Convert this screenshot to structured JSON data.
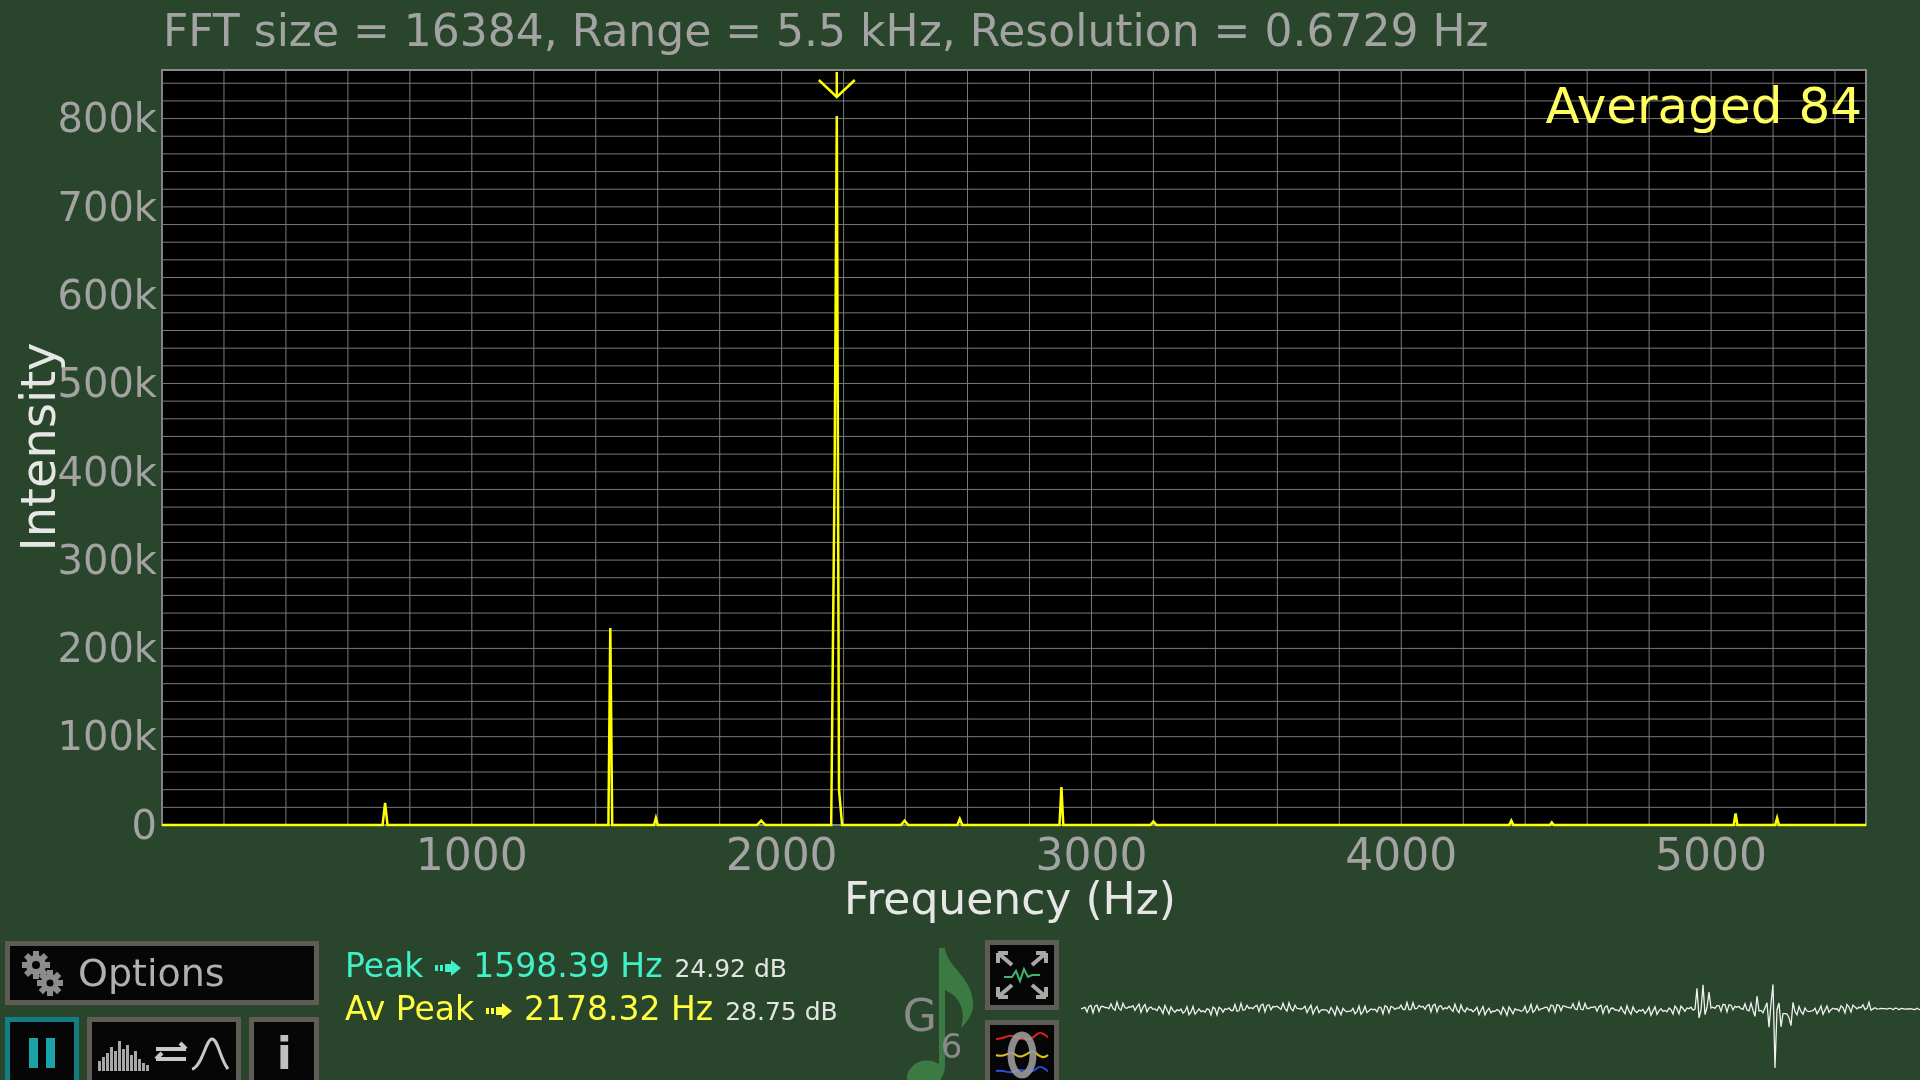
{
  "spectrum": {
    "title": "FFT size = 16384, Range = 5.5 kHz, Resolution = 0.6729 Hz",
    "status": "Averaged 84",
    "peak_marker": true,
    "chart_data": {
      "type": "line",
      "grid": true,
      "xlabel": "Frequency (Hz)",
      "ylabel": "Intensity",
      "xlim": [
        0,
        5500
      ],
      "ylim": [
        0,
        855000
      ],
      "xticks": [
        1000,
        2000,
        3000,
        4000,
        5000
      ],
      "yticks": [
        {
          "value": 0,
          "label": "0"
        },
        {
          "value": 100000,
          "label": "100k"
        },
        {
          "value": 200000,
          "label": "200k"
        },
        {
          "value": 300000,
          "label": "300k"
        },
        {
          "value": 400000,
          "label": "400k"
        },
        {
          "value": 500000,
          "label": "500k"
        },
        {
          "value": 600000,
          "label": "600k"
        },
        {
          "value": 700000,
          "label": "700k"
        },
        {
          "value": 800000,
          "label": "800k"
        }
      ],
      "x": [
        0,
        712,
        720,
        728,
        1441,
        1447,
        1453,
        1588,
        1594,
        1600,
        1920,
        1934,
        1948,
        2160,
        2171,
        2178,
        2185,
        2195,
        2385,
        2397,
        2409,
        2567,
        2575,
        2583,
        2897,
        2903,
        2909,
        3190,
        3200,
        3210,
        4348,
        4355,
        4362,
        4480,
        4486,
        4492,
        5073,
        5079,
        5085,
        5207,
        5213,
        5219,
        5500
      ],
      "series": [
        {
          "color": "#ffff00",
          "values": [
            0,
            0,
            25000,
            0,
            0,
            223000,
            0,
            0,
            8000,
            0,
            0,
            5000,
            0,
            0,
            400000,
            803000,
            40000,
            0,
            0,
            5000,
            0,
            0,
            7000,
            0,
            0,
            43000,
            0,
            0,
            4000,
            0,
            0,
            5000,
            0,
            0,
            3000,
            0,
            0,
            13000,
            0,
            0,
            8000,
            0,
            0
          ]
        }
      ]
    }
  },
  "controls": {
    "options_button": {
      "label": "Options"
    },
    "buttons": [
      {
        "kind": "pause",
        "active": true
      },
      {
        "kind": "view-toggle",
        "active": false
      },
      {
        "kind": "info",
        "label": "i",
        "active": false
      }
    ]
  },
  "readouts": [
    {
      "label": "Peak",
      "frequency": "1598.39 Hz",
      "level_db": "24.92 dB",
      "color": "#40f0c8"
    },
    {
      "label": "Av Peak",
      "frequency": "2178.32 Hz",
      "level_db": "28.75 dB",
      "color": "#ffff40"
    }
  ],
  "note": {
    "name": "G",
    "octave": "6"
  },
  "side_buttons": [
    {
      "kind": "autoscale"
    },
    {
      "kind": "zero"
    }
  ]
}
